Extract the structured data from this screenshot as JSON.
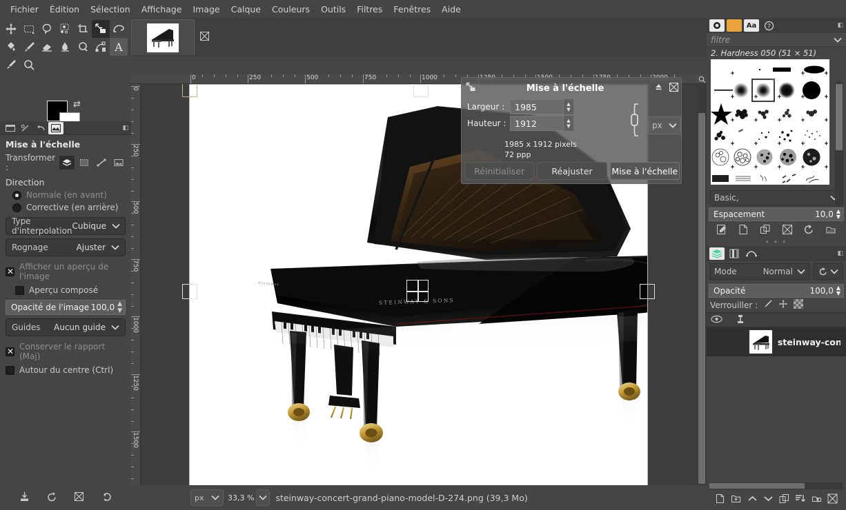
{
  "menubar": {
    "items": [
      {
        "label": "Fichier"
      },
      {
        "label": "Édition"
      },
      {
        "label": "Sélection"
      },
      {
        "label": "Affichage"
      },
      {
        "label": "Image"
      },
      {
        "label": "Calque"
      },
      {
        "label": "Couleurs"
      },
      {
        "label": "Outils"
      },
      {
        "label": "Filtres"
      },
      {
        "label": "Fenêtres"
      },
      {
        "label": "Aide"
      }
    ]
  },
  "toolbox": {
    "tools": [
      {
        "name": "move-tool",
        "icon": "move"
      },
      {
        "name": "rectangle-select-tool",
        "icon": "rect-select"
      },
      {
        "name": "free-select-tool",
        "icon": "lasso"
      },
      {
        "name": "fuzzy-select-tool",
        "icon": "fuzzy"
      },
      {
        "name": "crop-tool",
        "icon": "crop"
      },
      {
        "name": "unified-transform-tool",
        "icon": "transform",
        "active": true
      },
      {
        "name": "warp-transform-tool",
        "icon": "warp"
      },
      {
        "name": "bucket-fill-tool",
        "icon": "bucket"
      },
      {
        "name": "paintbrush-tool",
        "icon": "brush"
      },
      {
        "name": "eraser-tool",
        "icon": "eraser"
      },
      {
        "name": "smudge-tool",
        "icon": "smudge"
      },
      {
        "name": "clone-tool",
        "icon": "clone"
      },
      {
        "name": "paths-tool",
        "icon": "paths"
      },
      {
        "name": "text-tool",
        "icon": "text",
        "active2": true
      },
      {
        "name": "color-picker-tool",
        "icon": "picker"
      },
      {
        "name": "zoom-tool",
        "icon": "magnify"
      }
    ],
    "foreground_color": "#000000",
    "background_color": "#ffffff"
  },
  "tool_options": {
    "title": "Mise à l'échelle",
    "transform_label": "Transformer :",
    "transform_modes": [
      {
        "name": "transform-layer",
        "active": true
      },
      {
        "name": "transform-selection",
        "active": false
      },
      {
        "name": "transform-path",
        "active": false
      },
      {
        "name": "transform-image",
        "active": false
      }
    ],
    "direction_label": "Direction",
    "direction_normal": "Normale (en avant)",
    "direction_corrective": "Corrective (en arrière)",
    "direction_selected": "normal",
    "interpolation_label": "Type d'interpolation",
    "interpolation_value": "Cubique",
    "clipping_label": "Rognage",
    "clipping_value": "Ajuster",
    "show_preview_label": "Afficher un aperçu de l'image",
    "show_preview_checked": true,
    "composited_preview_label": "Aperçu composé",
    "composited_preview_checked": false,
    "opacity_label": "Opacité de l'image",
    "opacity_value": "100,0",
    "guides_label": "Guides",
    "guides_value": "Aucun guide",
    "keep_aspect_label": "Conserver le rapport (Maj)",
    "keep_aspect_checked": true,
    "around_center_label": "Autour du centre (Ctrl)",
    "around_center_checked": false,
    "bottom_icons": [
      {
        "name": "save-tool-preset-icon"
      },
      {
        "name": "restore-tool-preset-icon"
      },
      {
        "name": "delete-tool-preset-icon"
      },
      {
        "name": "reset-tool-options-icon"
      }
    ]
  },
  "image_window": {
    "tab_name": "steinway-concert-grand-piano-model-D-274.png",
    "ruler_h_ticks": [
      "0",
      "250",
      "500",
      "750",
      "1000",
      "1250",
      "1500",
      "1750",
      "2000"
    ],
    "ruler_v_ticks": [
      "0",
      "250",
      "500",
      "750",
      "1000",
      "1250",
      "1500"
    ]
  },
  "scale_dialog": {
    "title": "Mise à l'échelle",
    "width_label": "Largeur :",
    "width_value": "1985",
    "height_label": "Hauteur :",
    "height_value": "1912",
    "unit_value": "px",
    "size_info": "1985 x 1912 pixels",
    "resolution_info": "72 ppp",
    "chain_linked": true,
    "buttons": [
      {
        "label": "Réinitialiser",
        "name": "reset-button",
        "disabled": true
      },
      {
        "label": "Réajuster",
        "name": "readjust-button",
        "disabled": false
      },
      {
        "label": "Mise à l'échelle",
        "name": "scale-button",
        "primary": true
      }
    ]
  },
  "statusbar": {
    "unit": "px",
    "zoom": "33,3 %",
    "text": "steinway-concert-grand-piano-model-D-274.png (39,3 Mo)"
  },
  "right_dock": {
    "tabs": [
      {
        "name": "brushes-tab",
        "selected": true
      },
      {
        "name": "patterns-tab",
        "selected": false
      },
      {
        "name": "fonts-tab",
        "selected": false
      },
      {
        "name": "document-history-tab",
        "selected": false
      }
    ],
    "filter_placeholder": "filtre",
    "brush_name": "2. Hardness 050 (51 × 51)",
    "brush_set": "Basic,",
    "spacing_label": "Espacement",
    "spacing_value": "10,0",
    "brush_icons": [
      {
        "name": "edit-brush-icon"
      },
      {
        "name": "new-brush-icon"
      },
      {
        "name": "duplicate-brush-icon"
      },
      {
        "name": "delete-brush-icon"
      },
      {
        "name": "refresh-brushes-icon"
      },
      {
        "name": "open-brush-folder-icon"
      }
    ],
    "layer_tabs": [
      {
        "name": "layers-tab",
        "selected": true
      },
      {
        "name": "channels-tab",
        "selected": false
      },
      {
        "name": "paths-tab",
        "selected": false
      }
    ],
    "mode_label": "Mode",
    "mode_value": "Normal",
    "opacity_label": "Opacité",
    "opacity_value": "100,0",
    "lock_label": "Verrouiller :",
    "lock_icons": [
      {
        "name": "lock-pixels-icon"
      },
      {
        "name": "lock-position-icon"
      },
      {
        "name": "lock-alpha-icon"
      }
    ],
    "layers": [
      {
        "name": "steinway-conc",
        "visible": true,
        "linked": false
      }
    ],
    "bottom_icons": [
      {
        "name": "new-layer-icon"
      },
      {
        "name": "new-layer-group-icon"
      },
      {
        "name": "raise-layer-icon"
      },
      {
        "name": "lower-layer-icon"
      },
      {
        "name": "duplicate-layer-icon"
      },
      {
        "name": "merge-down-icon"
      },
      {
        "name": "anchor-layer-icon"
      },
      {
        "name": "delete-layer-icon"
      }
    ]
  },
  "colors": {
    "panel_bg": "#454545",
    "dark_bg": "#3d3d3d",
    "accent_orange": "#e8a33d",
    "handle_gold": "#c7b481",
    "text": "#c3c3c3"
  }
}
